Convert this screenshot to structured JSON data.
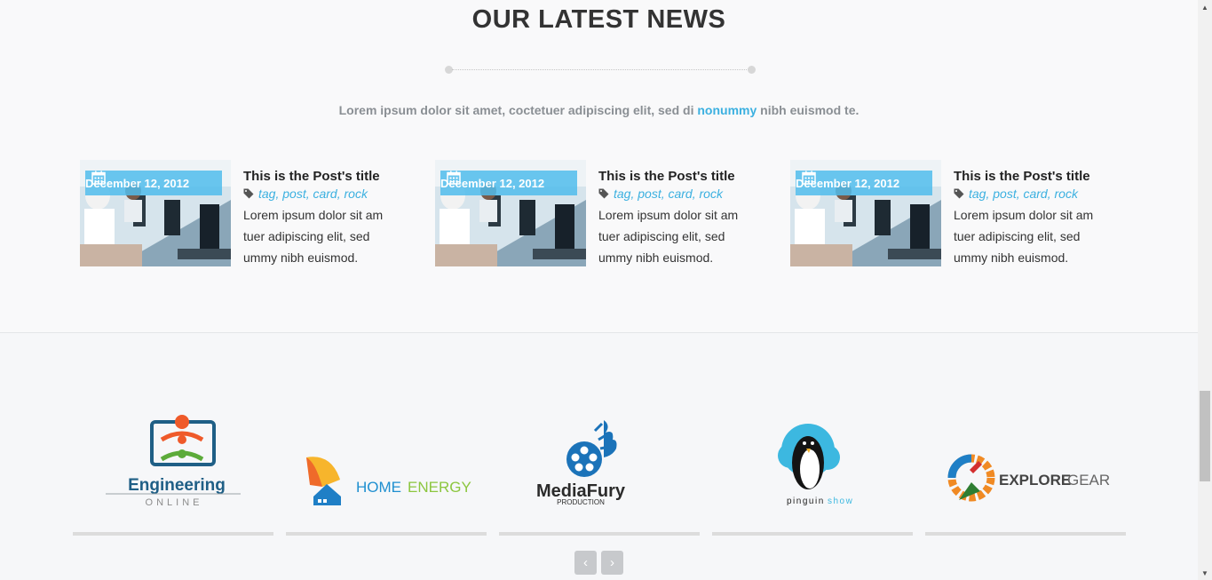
{
  "news": {
    "title": "OUR LATEST NEWS",
    "intro_before": "Lorem ipsum dolor sit amet, coctetuer adipiscing elit, sed di",
    "intro_highlight": "nonummy",
    "intro_after": "nibh euismod te.",
    "posts": [
      {
        "date": "December 12, 2012",
        "title": "This is the Post's title",
        "tags": "tag, post, card, rock",
        "excerpt": "Lorem ipsum dolor sit am tuer adipiscing elit, sed ummy nibh euismod."
      },
      {
        "date": "December 12, 2012",
        "title": "This is the Post's title",
        "tags": "tag, post, card, rock",
        "excerpt": "Lorem ipsum dolor sit am tuer adipiscing elit, sed ummy nibh euismod."
      },
      {
        "date": "December 12, 2012",
        "title": "This is the Post's title",
        "tags": "tag, post, card, rock",
        "excerpt": "Lorem ipsum dolor sit am tuer adipiscing elit, sed ummy nibh euismod."
      }
    ]
  },
  "clients": {
    "logos": [
      {
        "name": "Engineering",
        "sub": "ONLINE"
      },
      {
        "name": "HOME",
        "name2": "ENERGY"
      },
      {
        "name": "MediaFury",
        "sub": "PRODUCTION"
      },
      {
        "name": "pinguin",
        "name2": "show"
      },
      {
        "name": "EXPLORE",
        "name2": "GEAR"
      }
    ],
    "prev_icon": "chevron-left-icon",
    "next_icon": "chevron-right-icon",
    "prev_glyph": "‹",
    "next_glyph": "›"
  },
  "colors": {
    "accent": "#3bb0e0",
    "badge": "#50bcec"
  }
}
